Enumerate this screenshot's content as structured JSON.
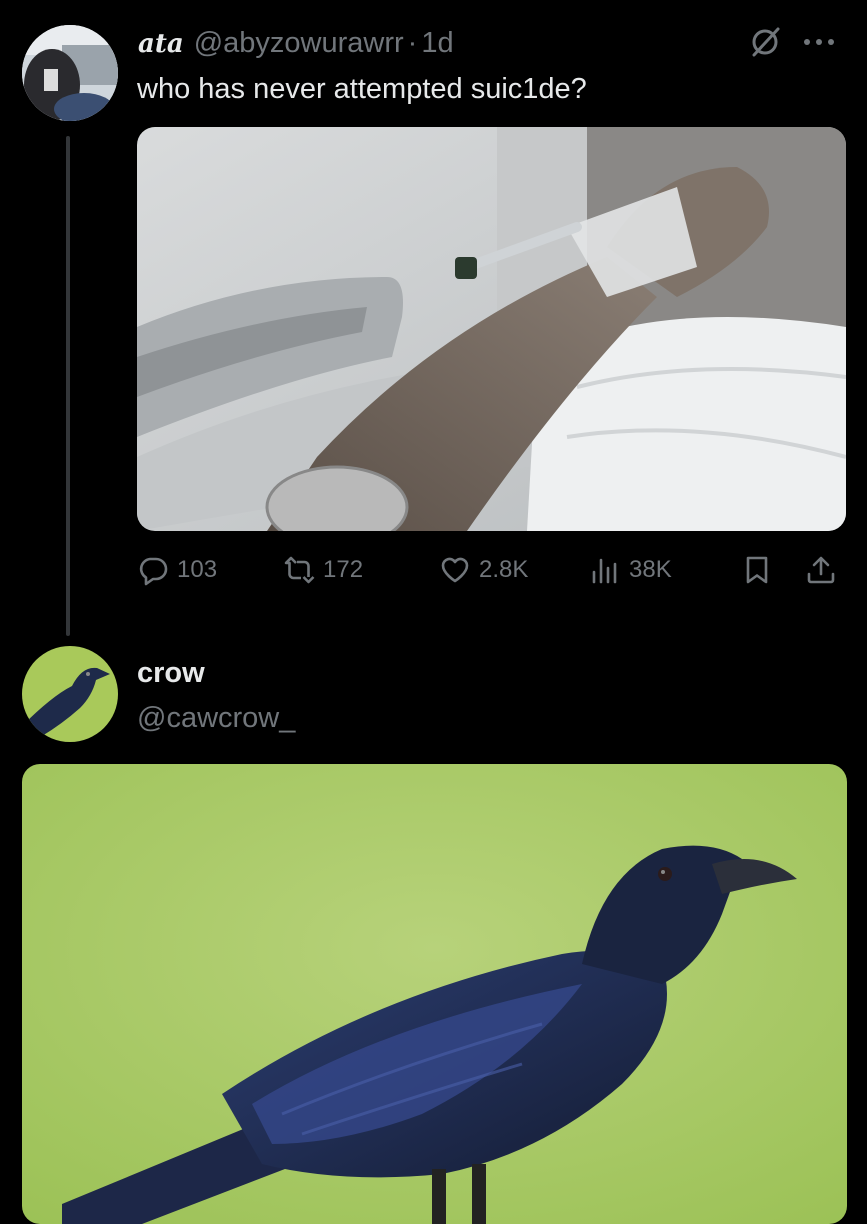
{
  "tweet1": {
    "display_name": "ata",
    "handle": "@abyzowurawrr",
    "separator": "·",
    "time": "1d",
    "text": "who has never attempted suic1de?",
    "media_description": "hospital bed photo of arm with IV line",
    "actions": {
      "replies": "103",
      "retweets": "172",
      "likes": "2.8K",
      "views": "38K"
    },
    "icons": [
      "grok-icon",
      "more-icon",
      "reply-icon",
      "retweet-icon",
      "like-icon",
      "views-icon",
      "bookmark-icon",
      "share-icon"
    ]
  },
  "tweet2": {
    "display_name": "crow",
    "handle": "@cawcrow_",
    "media_description": "crow perched against green background"
  },
  "colors": {
    "background": "#000000",
    "text_primary": "#e7e9ea",
    "text_secondary": "#71767b",
    "thread_line": "#333639"
  }
}
